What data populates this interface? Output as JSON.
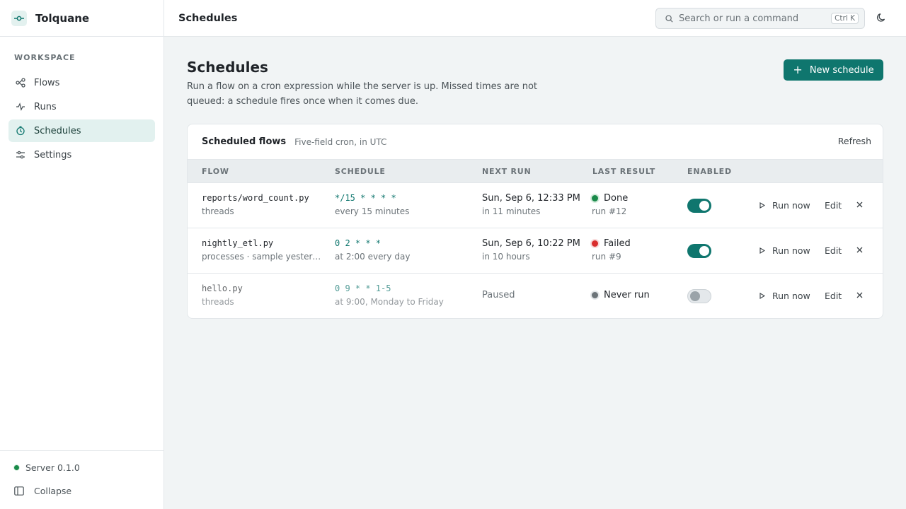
{
  "brand": {
    "name": "Tolquane"
  },
  "sidebar": {
    "section": "WORKSPACE",
    "items": [
      {
        "label": "Flows",
        "icon": "flows-icon"
      },
      {
        "label": "Runs",
        "icon": "activity-icon"
      },
      {
        "label": "Schedules",
        "icon": "clock-icon",
        "active": true
      },
      {
        "label": "Settings",
        "icon": "sliders-icon"
      }
    ],
    "server_status": "Server 0.1.0",
    "collapse_label": "Collapse"
  },
  "topbar": {
    "title": "Schedules",
    "search_placeholder": "Search or run a command",
    "search_shortcut": "Ctrl K"
  },
  "page": {
    "title": "Schedules",
    "description": "Run a flow on a cron expression while the server is up. Missed times are not queued: a schedule fires once when it comes due.",
    "new_button": "New schedule"
  },
  "card": {
    "title": "Scheduled flows",
    "subtitle": "Five-field cron, in UTC",
    "refresh": "Refresh",
    "columns": [
      "FLOW",
      "SCHEDULE",
      "NEXT RUN",
      "LAST RESULT",
      "ENABLED"
    ],
    "rows": [
      {
        "flow": "reports/word_count.py",
        "runner": "threads",
        "cron": "*/15 * * * *",
        "cron_desc": "every 15 minutes",
        "next_run": "Sun, Sep 6, 12:33 PM",
        "next_run_rel": "in 11 minutes",
        "result": "Done",
        "result_status": "success",
        "result_run": "run #12",
        "enabled": true,
        "run_now": "Run now",
        "edit": "Edit"
      },
      {
        "flow": "nightly_etl.py",
        "runner": "processes · sample yesterday",
        "cron": "0 2 * * *",
        "cron_desc": "at 2:00 every day",
        "next_run": "Sun, Sep 6, 10:22 PM",
        "next_run_rel": "in 10 hours",
        "result": "Failed",
        "result_status": "failed",
        "result_run": "run #9",
        "enabled": true,
        "run_now": "Run now",
        "edit": "Edit"
      },
      {
        "flow": "hello.py",
        "runner": "threads",
        "cron": "0 9 * * 1-5",
        "cron_desc": "at 9:00, Monday to Friday",
        "next_run": "Paused",
        "next_run_rel": "",
        "result": "Never run",
        "result_status": "none",
        "result_run": "",
        "enabled": false,
        "run_now": "Run now",
        "edit": "Edit"
      }
    ]
  },
  "colors": {
    "accent": "#0f766e",
    "success": "#1a8a4a",
    "failed": "#d92d2d",
    "none": "#6b7378"
  }
}
